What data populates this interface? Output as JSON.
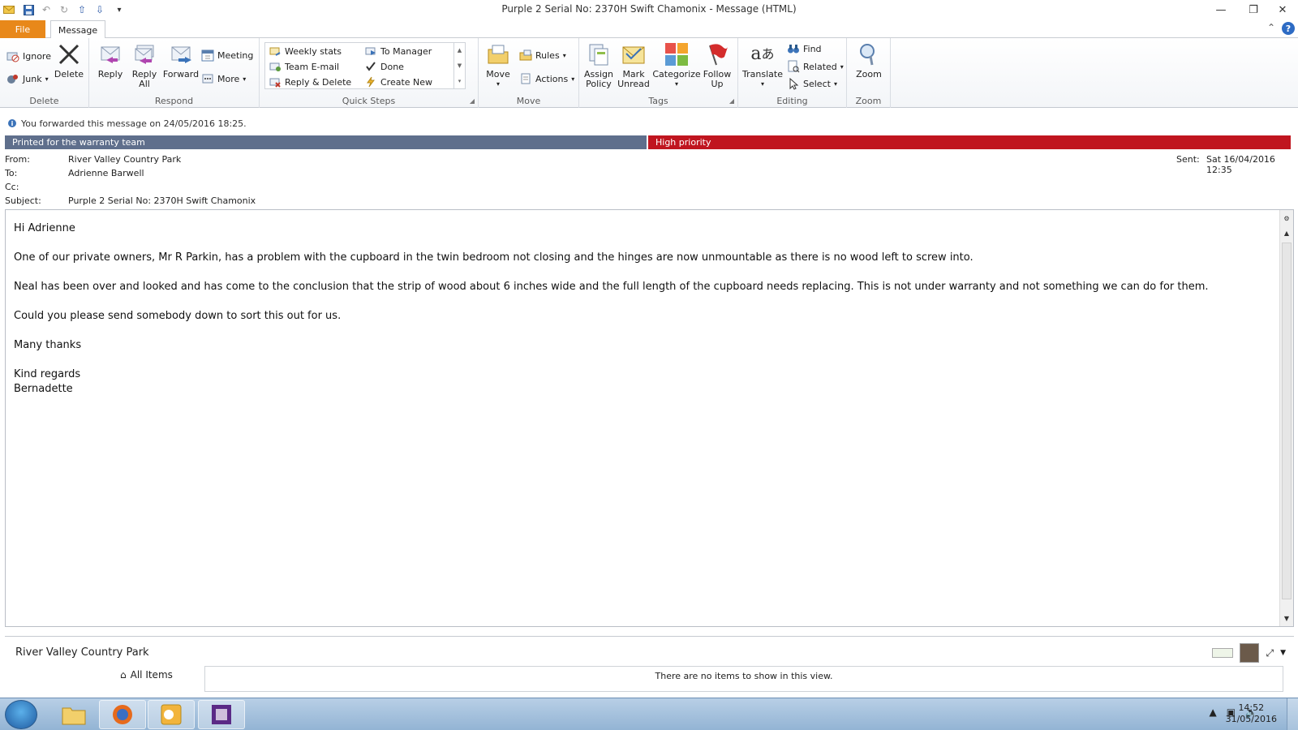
{
  "window": {
    "title": "Purple 2 Serial No: 2370H Swift Chamonix  -  Message (HTML)"
  },
  "tabs": {
    "file": "File",
    "message": "Message"
  },
  "ribbon": {
    "delete_group": {
      "label": "Delete",
      "ignore": "Ignore",
      "junk": "Junk",
      "delete": "Delete"
    },
    "respond_group": {
      "label": "Respond",
      "reply": "Reply",
      "reply_all_1": "Reply",
      "reply_all_2": "All",
      "forward": "Forward",
      "meeting": "Meeting",
      "more": "More"
    },
    "quicksteps_group": {
      "label": "Quick Steps",
      "items": [
        "Weekly stats",
        "To Manager",
        "Team E-mail",
        "Done",
        "Reply & Delete",
        "Create New"
      ]
    },
    "move_group": {
      "label": "Move",
      "move": "Move",
      "rules": "Rules",
      "actions": "Actions"
    },
    "tags_group": {
      "label": "Tags",
      "assign_policy_1": "Assign",
      "assign_policy_2": "Policy",
      "mark_unread_1": "Mark",
      "mark_unread_2": "Unread",
      "categorize": "Categorize",
      "follow_up_1": "Follow",
      "follow_up_2": "Up"
    },
    "editing_group": {
      "label": "Editing",
      "translate": "Translate",
      "find": "Find",
      "related": "Related",
      "select": "Select"
    },
    "zoom_group": {
      "label": "Zoom",
      "zoom": "Zoom"
    }
  },
  "infobar": {
    "text": "You forwarded this message on 24/05/2016 18:25."
  },
  "categories": {
    "warranty": "Printed for the warranty team",
    "priority": "High priority",
    "warranty_color": "#5f6f8c",
    "priority_color": "#c0151f"
  },
  "header": {
    "from_label": "From:",
    "from_value": "River Valley Country Park",
    "to_label": "To:",
    "to_value": "Adrienne Barwell",
    "cc_label": "Cc:",
    "subject_label": "Subject:",
    "subject_value": "Purple 2 Serial No: 2370H Swift Chamonix",
    "sent_label": "Sent:",
    "sent_value": "Sat 16/04/2016 12:35"
  },
  "message": {
    "greeting": "Hi Adrienne",
    "p1": "One of our private owners, Mr R Parkin, has a problem with the cupboard in the twin bedroom not closing and the hinges are now unmountable as there is no wood left to screw into.",
    "p2": "Neal has been over and looked and has come to the conclusion that the strip of wood about 6 inches wide and the full length of the cupboard needs replacing. This is not under warranty and not something we can do for them.",
    "p3": "Could you please send somebody down to sort this out for us.",
    "p4": "Many thanks",
    "closing": "Kind regards",
    "signature": "Bernadette"
  },
  "people_pane": {
    "name": "River Valley Country Park",
    "all_items": "All Items",
    "empty_text": "There are no items to show in this view."
  },
  "taskbar": {
    "time": "14:52",
    "date": "31/05/2016"
  }
}
